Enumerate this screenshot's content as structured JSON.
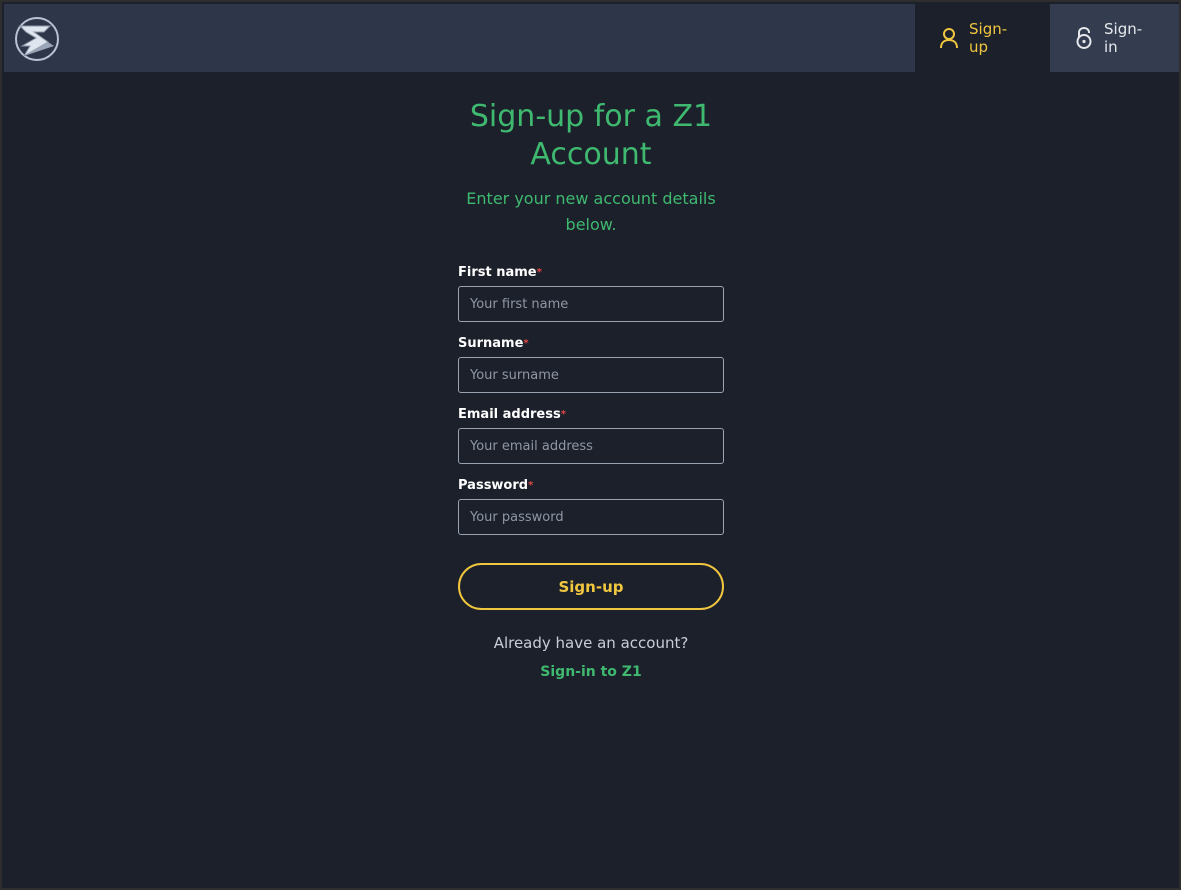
{
  "brand": {
    "logo_icon": "z1-logo-icon"
  },
  "nav": {
    "signup": {
      "label": "Sign-up",
      "icon": "user-icon",
      "active": true
    },
    "signin": {
      "label": "Sign-in",
      "icon": "unlock-icon",
      "active": false
    }
  },
  "form": {
    "title": "Sign-up for a Z1 Account",
    "subtitle": "Enter your new account details below.",
    "required_marker": "*",
    "fields": [
      {
        "label": "First name",
        "placeholder": "Your first name",
        "value": ""
      },
      {
        "label": "Surname",
        "placeholder": "Your surname",
        "value": ""
      },
      {
        "label": "Email address",
        "placeholder": "Your email address",
        "value": ""
      },
      {
        "label": "Password",
        "placeholder": "Your password",
        "value": ""
      }
    ],
    "submit_label": "Sign-up",
    "already_text": "Already have an account?",
    "signin_link": "Sign-in to Z1"
  },
  "colors": {
    "background": "#1b202b",
    "topbar": "#2e3749",
    "accent_green": "#3fb96f",
    "accent_yellow": "#f1c63f",
    "required_red": "#e04848"
  }
}
